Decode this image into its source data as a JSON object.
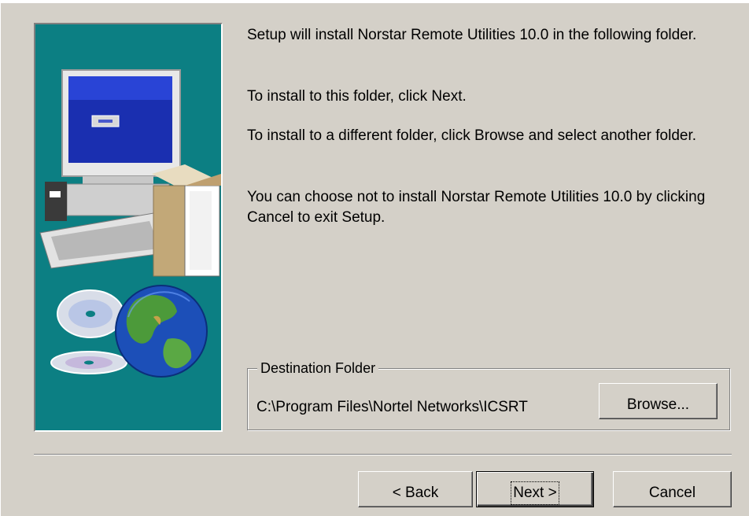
{
  "messages": {
    "line1": "Setup will install Norstar Remote Utilities 10.0 in the following folder.",
    "line2": "To install to this folder, click Next.",
    "line3": "To install to a different folder, click Browse and select another folder.",
    "line4": "You can choose not to install Norstar Remote Utilities 10.0 by clicking Cancel to exit Setup."
  },
  "destination": {
    "group_title": "Destination Folder",
    "path": "C:\\Program Files\\Nortel Networks\\ICSRT",
    "browse_label": "Browse..."
  },
  "buttons": {
    "back_label": "< Back",
    "next_label": "Next >",
    "cancel_label": "Cancel"
  },
  "illustration": {
    "icons": [
      "computer-monitor-icon",
      "keyboard-icon",
      "box-icon",
      "cd-disc-icon",
      "globe-icon"
    ],
    "background_color": "#0c7f83"
  }
}
